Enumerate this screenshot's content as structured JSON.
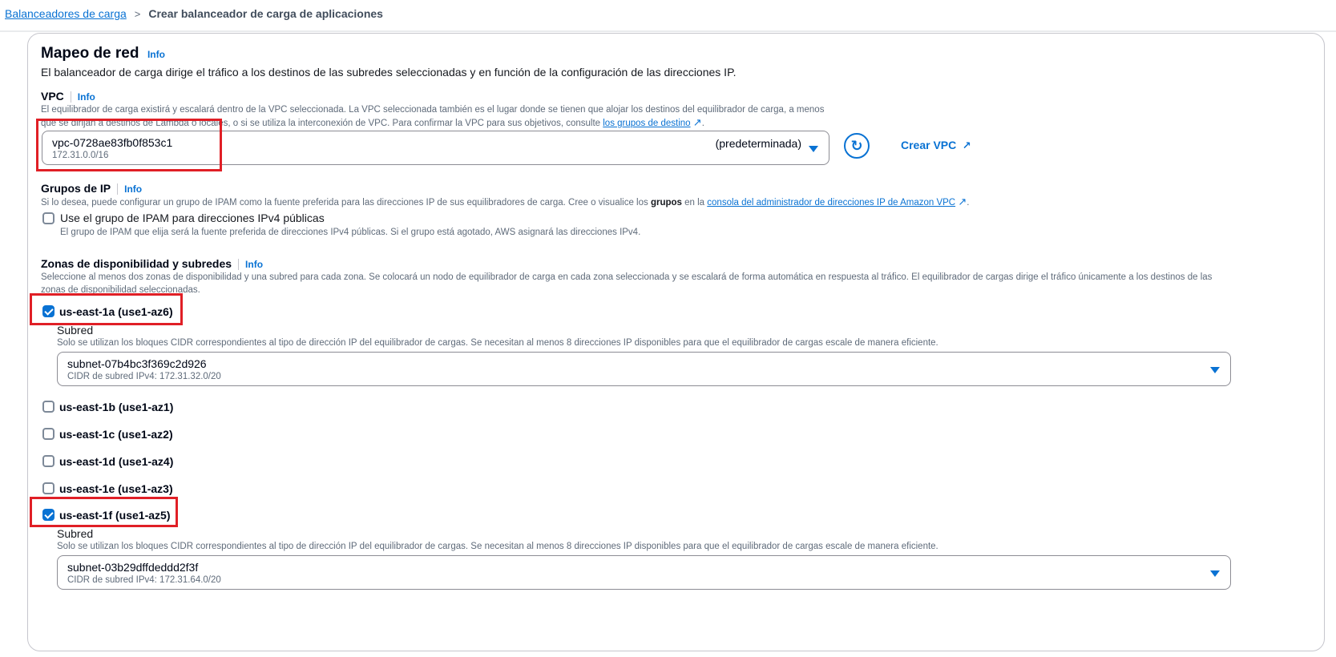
{
  "breadcrumb": {
    "parent": "Balanceadores de carga",
    "separator": ">",
    "current": "Crear balanceador de carga de aplicaciones"
  },
  "section": {
    "title": "Mapeo de red",
    "info": "Info",
    "description": "El balanceador de carga dirige el tráfico a los destinos de las subredes seleccionadas y en función de la configuración de las direcciones IP."
  },
  "vpc": {
    "label": "VPC",
    "info": "Info",
    "description_line1": "El equilibrador de carga existirá y escalará dentro de la VPC seleccionada. La VPC seleccionada también es el lugar donde se tienen que alojar los destinos del equilibrador de carga, a menos",
    "description_line2": "que se dirijan a destinos de Lambda o locales, o si se utiliza la interconexión de VPC. Para confirmar la VPC para sus objetivos, consulte",
    "description_link": "los grupos de destino",
    "selected_id": "vpc-0728ae83fb0f853c1",
    "selected_cidr": "172.31.0.0/16",
    "selected_tag": "(predeterminada)",
    "refresh_icon": "refresh-icon",
    "create_label": "Crear VPC"
  },
  "ip_pools": {
    "label": "Grupos de IP",
    "info": "Info",
    "description_pre": "Si lo desea, puede configurar un grupo de IPAM como la fuente preferida para las direcciones IP de sus equilibradores de carga. Cree o visualice los",
    "description_bold": "grupos",
    "description_mid": "en la",
    "description_link": "consola del administrador de direcciones IP de Amazon VPC",
    "checkbox_label": "Use el grupo de IPAM para direcciones IPv4 públicas",
    "checkbox_checked": false,
    "checkbox_help": "El grupo de IPAM que elija será la fuente preferida de direcciones IPv4 públicas. Si el grupo está agotado, AWS asignará las direcciones IPv4."
  },
  "zones": {
    "label": "Zonas de disponibilidad y subredes",
    "info": "Info",
    "description_line1": "Seleccione al menos dos zonas de disponibilidad y una subred para cada zona. Se colocará un nodo de equilibrador de carga en cada zona seleccionada y se escalará de forma automática en respuesta al tráfico. El equilibrador de cargas dirige el tráfico únicamente a los destinos de las",
    "description_line2": "zonas de disponibilidad seleccionadas.",
    "subnet_label": "Subred",
    "subnet_help": "Solo se utilizan los bloques CIDR correspondientes al tipo de dirección IP del equilibrador de cargas. Se necesitan al menos 8 direcciones IP disponibles para que el equilibrador de cargas escale de manera eficiente.",
    "items": [
      {
        "name": "us-east-1a (use1-az6)",
        "checked": true,
        "subnet_id": "subnet-07b4bc3f369c2d926",
        "subnet_cidr": "CIDR de subred IPv4: 172.31.32.0/20"
      },
      {
        "name": "us-east-1b (use1-az1)",
        "checked": false
      },
      {
        "name": "us-east-1c (use1-az2)",
        "checked": false
      },
      {
        "name": "us-east-1d (use1-az4)",
        "checked": false
      },
      {
        "name": "us-east-1e (use1-az3)",
        "checked": false
      },
      {
        "name": "us-east-1f (use1-az5)",
        "checked": true,
        "subnet_id": "subnet-03b29dffdeddd2f3f",
        "subnet_cidr": "CIDR de subred IPv4: 172.31.64.0/20"
      }
    ]
  },
  "colors": {
    "link": "#0972d3",
    "highlight": "#e01f26"
  }
}
